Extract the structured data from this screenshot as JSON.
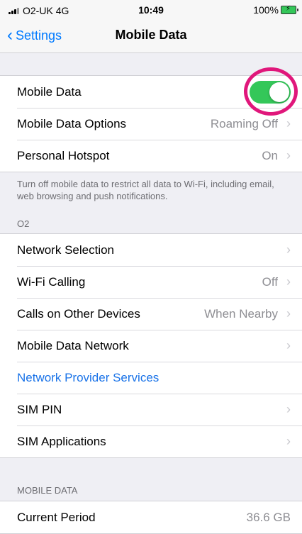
{
  "status_bar": {
    "carrier": "O2-UK",
    "network": "4G",
    "time": "10:49",
    "battery": "100%"
  },
  "nav": {
    "back_label": "Settings",
    "title": "Mobile Data"
  },
  "group1": {
    "mobile_data": {
      "label": "Mobile Data",
      "toggle_on": true
    },
    "mobile_data_options": {
      "label": "Mobile Data Options",
      "value": "Roaming Off"
    },
    "personal_hotspot": {
      "label": "Personal Hotspot",
      "value": "On"
    }
  },
  "group1_footer": "Turn off mobile data to restrict all data to Wi-Fi, including email, web browsing and push notifications.",
  "carrier_section": {
    "header": "O2",
    "network_selection": {
      "label": "Network Selection"
    },
    "wifi_calling": {
      "label": "Wi-Fi Calling",
      "value": "Off"
    },
    "calls_other_devices": {
      "label": "Calls on Other Devices",
      "value": "When Nearby"
    },
    "mobile_data_network": {
      "label": "Mobile Data Network"
    },
    "network_provider_services": {
      "label": "Network Provider Services"
    },
    "sim_pin": {
      "label": "SIM PIN"
    },
    "sim_applications": {
      "label": "SIM Applications"
    }
  },
  "usage_section": {
    "header": "MOBILE DATA",
    "current_period": {
      "label": "Current Period",
      "value": "36.6 GB"
    }
  },
  "colors": {
    "accent": "#007aff",
    "toggle_on": "#34c759",
    "link": "#1a73e8",
    "highlight": "#e0177b"
  }
}
